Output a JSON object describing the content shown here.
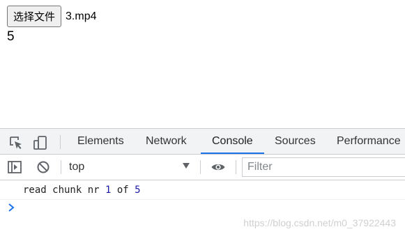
{
  "page": {
    "file_button_label": "选择文件",
    "file_name": "3.mp4",
    "count_text": "5"
  },
  "devtools": {
    "tabs": [
      {
        "label": "Elements",
        "active": false
      },
      {
        "label": "Network",
        "active": false
      },
      {
        "label": "Console",
        "active": true
      },
      {
        "label": "Sources",
        "active": false
      },
      {
        "label": "Performance",
        "active": false
      }
    ],
    "toolbar": {
      "context": "top",
      "filter_placeholder": "Filter"
    },
    "console": {
      "log_prefix": "read chunk nr ",
      "log_current": "1",
      "log_middle": " of ",
      "log_total": "5"
    },
    "accent_color": "#1a73e8"
  },
  "watermark": "https://blog.csdn.net/m0_37922443"
}
